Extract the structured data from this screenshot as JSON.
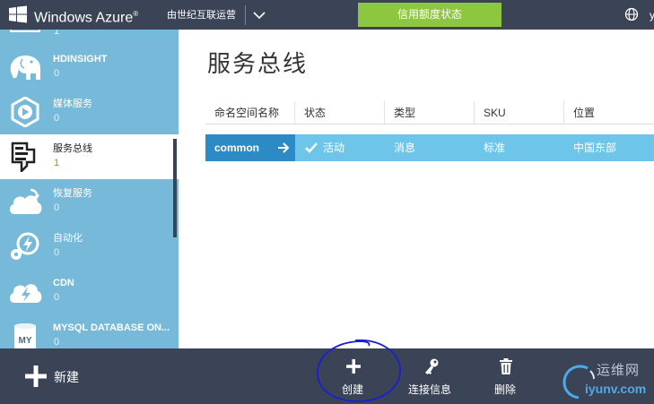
{
  "header": {
    "brand": "Windows Azure",
    "brand_mark": "®",
    "subscription": "由世纪互联运营",
    "credit_banner": "信用额度状态",
    "user_initial": "y"
  },
  "sidebar": {
    "top_partial_count": "1",
    "items": [
      {
        "label": "HDINSIGHT",
        "count": "0",
        "icon": "hdinsight-elephant-icon"
      },
      {
        "label": "媒体服务",
        "count": "0",
        "icon": "media-services-icon"
      },
      {
        "label": "服务总线",
        "count": "1",
        "icon": "service-bus-icon",
        "active": true
      },
      {
        "label": "恢复服务",
        "count": "0",
        "icon": "recovery-services-icon"
      },
      {
        "label": "自动化",
        "count": "0",
        "icon": "automation-icon"
      },
      {
        "label": "CDN",
        "count": "0",
        "icon": "cdn-icon"
      },
      {
        "label": "MYSQL DATABASE ON...",
        "count": "0",
        "icon": "mysql-icon",
        "badge": "MY"
      }
    ]
  },
  "main": {
    "title": "服务总线",
    "columns": [
      "命名空间名称",
      "状态",
      "类型",
      "SKU",
      "位置"
    ],
    "rows": [
      {
        "name": "common",
        "status": "活动",
        "type": "消息",
        "sku": "标准",
        "location": "中国东部"
      }
    ]
  },
  "commandbar": {
    "new_label": "新建",
    "commands": [
      {
        "label": "创建",
        "icon": "plus-icon"
      },
      {
        "label": "连接信息",
        "icon": "key-icon"
      },
      {
        "label": "删除",
        "icon": "trash-icon"
      }
    ]
  },
  "watermark": {
    "cn": "运维网",
    "url": "iyunv.com"
  },
  "colors": {
    "topbar": "#3b4456",
    "sidebar": "#77b9d8",
    "credit_banner": "#8dc63f",
    "selected_row": "#6dc6ea",
    "selected_name_cell": "#2c8bc4"
  }
}
